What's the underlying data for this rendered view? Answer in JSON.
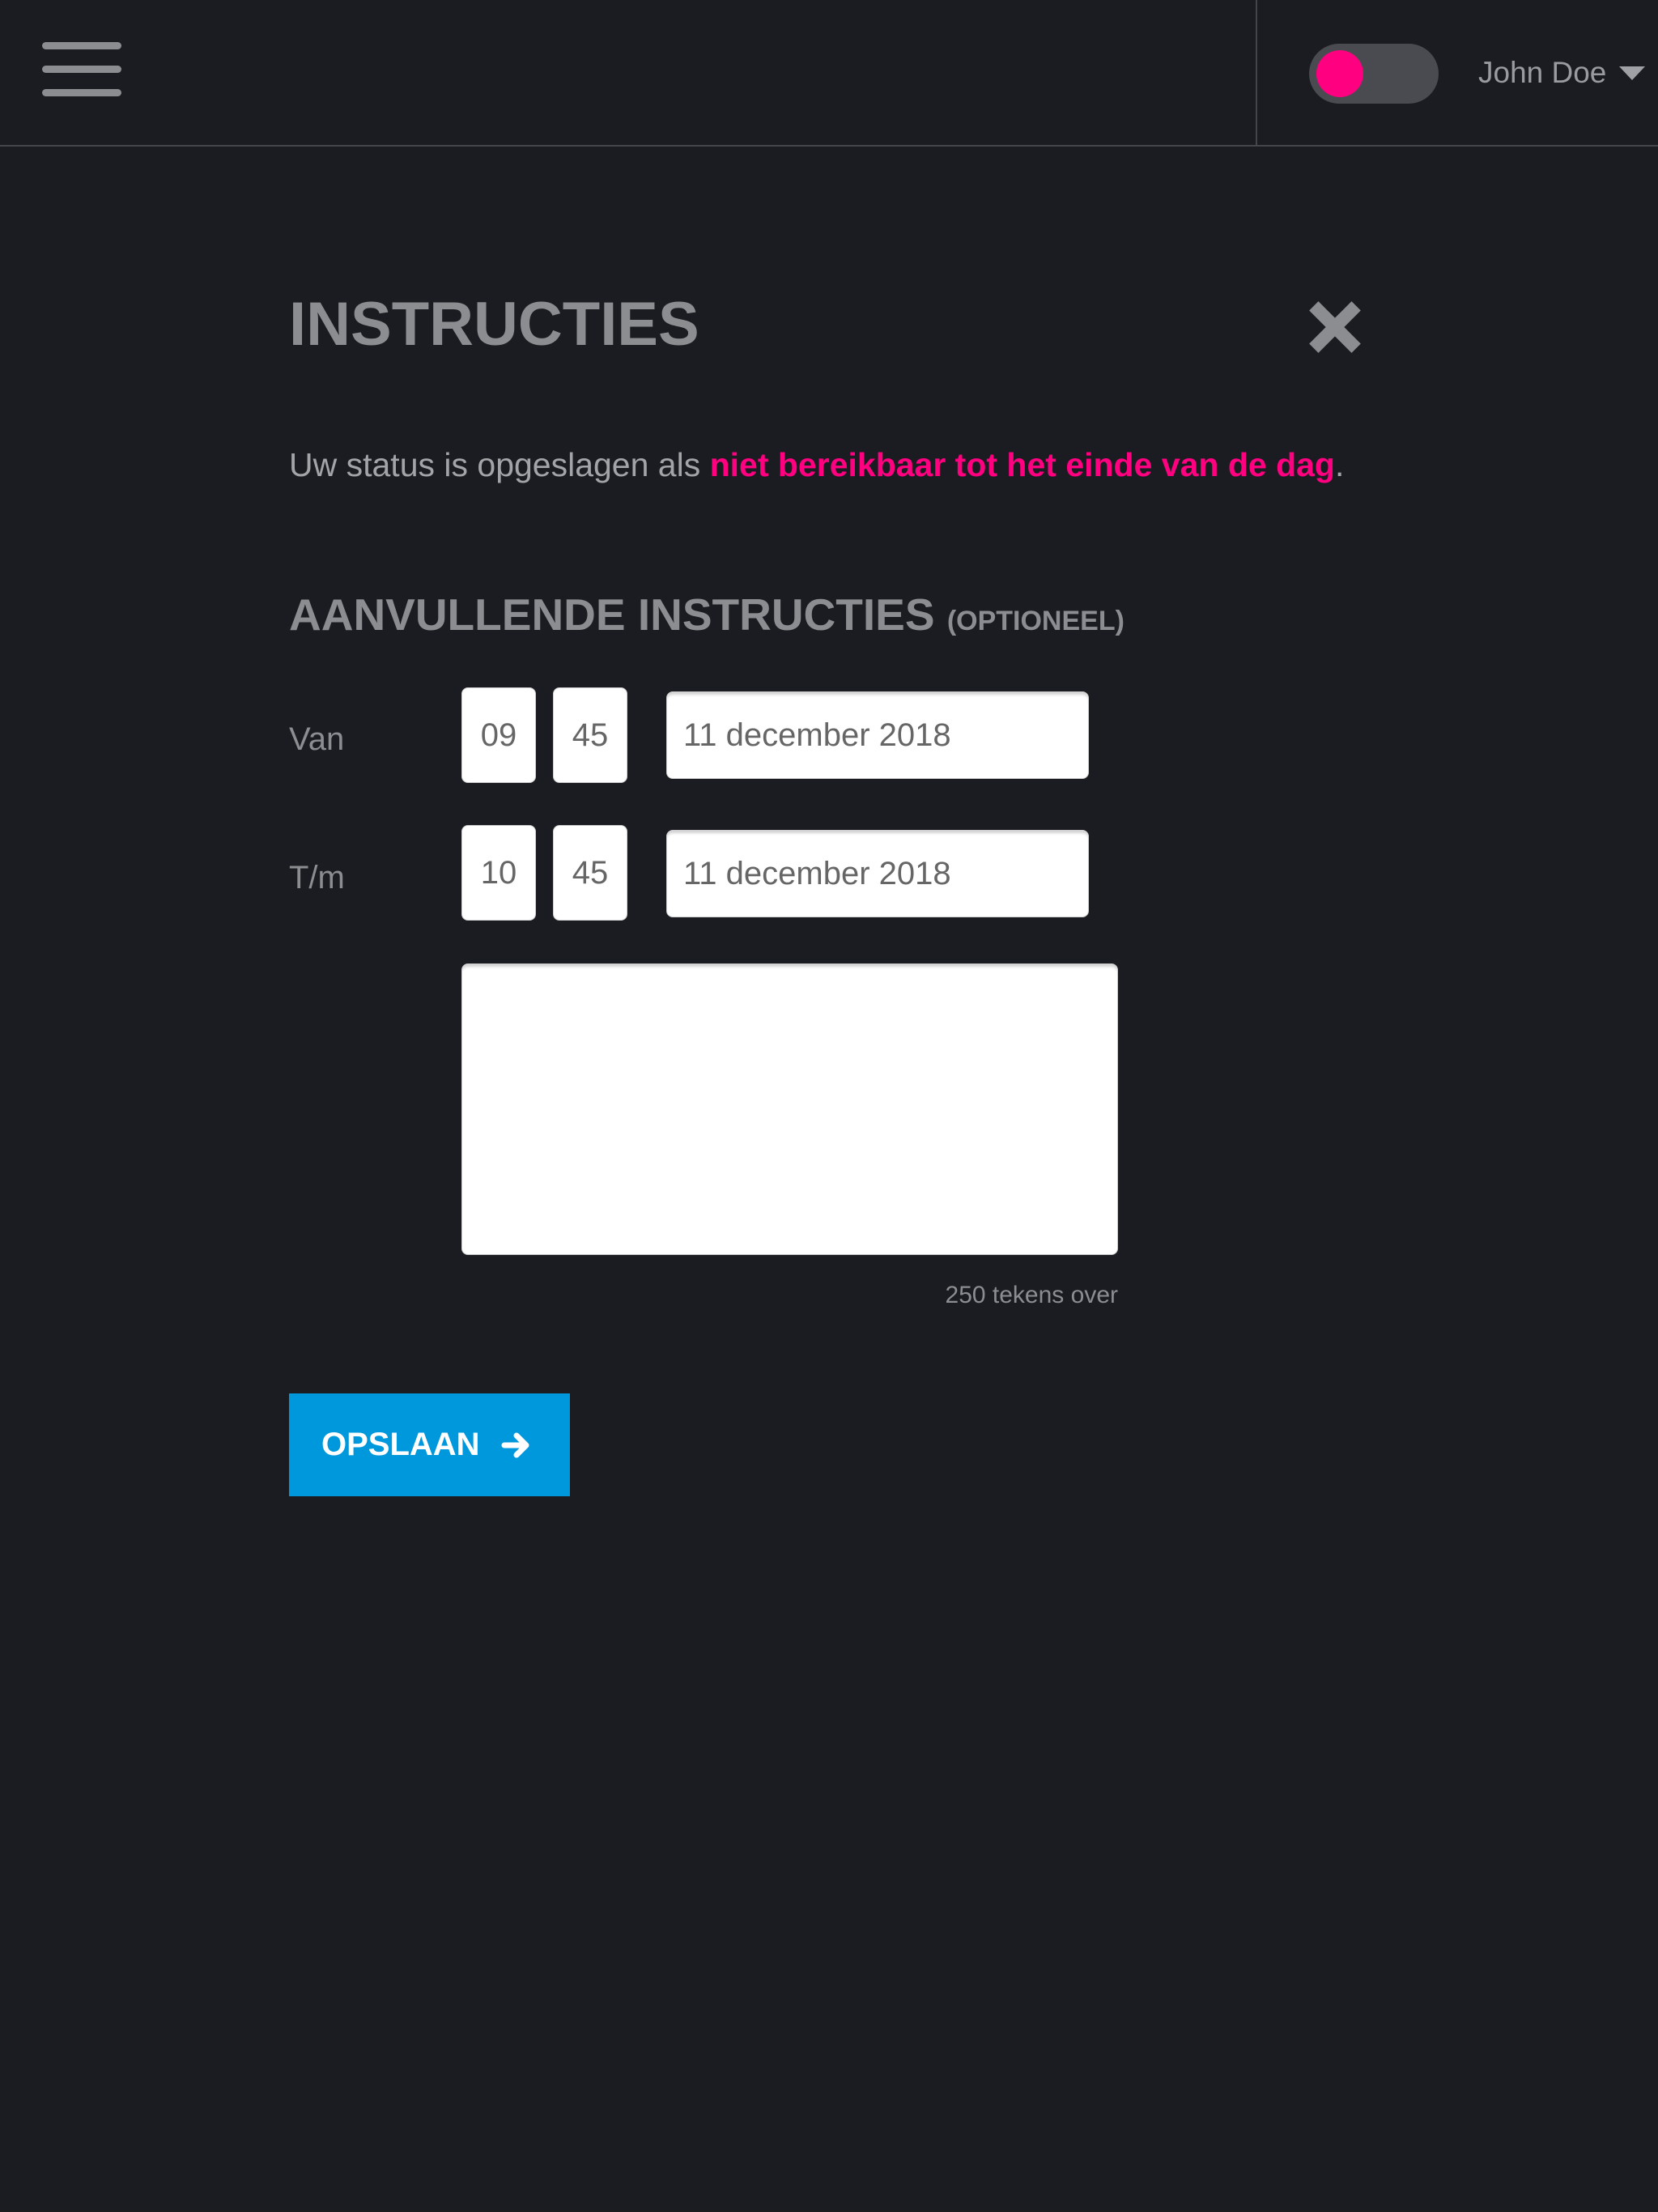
{
  "header": {
    "menu_icon": "hamburger-menu-icon",
    "status_toggle": {
      "on": true,
      "color": "#ff0080"
    },
    "user_name": "John Doe",
    "user_menu_icon": "caret-down-icon"
  },
  "dialog": {
    "title": "INSTRUCTIES",
    "close_icon": "close-icon",
    "status_prefix": "Uw status is opgeslagen als ",
    "status_highlight": "niet bereikbaar tot het einde van de dag",
    "status_suffix": ".",
    "subtitle": "AANVULLENDE INSTRUCTIES",
    "subtitle_optional": "(OPTIONEEL)",
    "from": {
      "label": "Van",
      "hour": "09",
      "minute": "45",
      "date": "11 december 2018"
    },
    "until": {
      "label": "T/m",
      "hour": "10",
      "minute": "45",
      "date": "11 december 2018"
    },
    "instructions_text": "",
    "chars_left": "250 tekens over",
    "save_label": "OPSLAAN",
    "save_icon": "arrow-right-icon"
  },
  "colors": {
    "background": "#1b1c21",
    "accent": "#ff0080",
    "button": "#0098dd",
    "muted_text": "#8c8d91"
  }
}
